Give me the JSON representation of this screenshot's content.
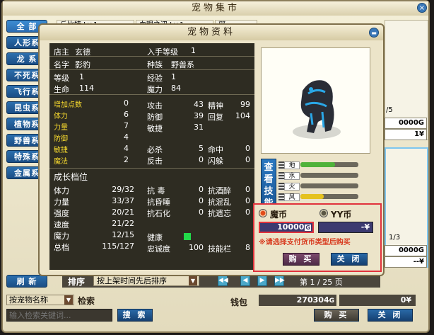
{
  "market": {
    "title": "宠物集市",
    "categories": [
      "全 部",
      "人形系",
      "龙 系",
      "不死系",
      "飞行系",
      "昆虫系",
      "植物系",
      "野兽系",
      "特殊系",
      "金属系"
    ],
    "bg_tab_labels": [
      "丘比特 Lv.1",
      "血眼之辺 Lv.1",
      "邪"
    ],
    "refresh_label": "刷 新",
    "sort_label": "排序",
    "sort_value": "按上架时间先后排序",
    "page_label": "第",
    "page_current": "1",
    "page_sep": "/",
    "page_total": "25",
    "page_unit": "页",
    "search_mode": "按宠物名称",
    "search_label": "检索",
    "search_placeholder": "输入检索关键词...",
    "search_button": "搜 索",
    "wallet_label": "钱包",
    "wallet_gold": "270304",
    "wallet_gold_unit": "G",
    "wallet_yy": "0",
    "wallet_yy_unit": "¥",
    "buy_label": "购 买",
    "close_label": "关 闭",
    "right_prices": [
      "0000G",
      "1¥",
      "0000G",
      "--¥"
    ],
    "right_level_1": "/5",
    "right_level_2": "1/3"
  },
  "info": {
    "title": "宠物资料",
    "owner_label": "店主",
    "owner": "玄德",
    "entry_label": "入手等级",
    "entry": "1",
    "name_label": "名字",
    "name": "影豹",
    "race_label": "种族",
    "race": "野兽系",
    "level_label": "等级",
    "level": "1",
    "exp_label": "经验",
    "exp": "1",
    "hp_label": "生命",
    "hp": "114",
    "mp_label": "魔力",
    "mp": "84",
    "points": [
      {
        "label": "增加点数",
        "value": "0"
      },
      {
        "label": "体力",
        "value": "6"
      },
      {
        "label": "力量",
        "value": "7"
      },
      {
        "label": "防御",
        "value": "4"
      },
      {
        "label": "敏捷",
        "value": "4"
      },
      {
        "label": "魔法",
        "value": "2"
      }
    ],
    "attack_label": "攻击",
    "attack": "43",
    "spirit_label": "精神",
    "spirit": "99",
    "defense_label": "防御",
    "defense": "39",
    "recover_label": "回复",
    "recover": "104",
    "agility_label": "敏捷",
    "agility": "31",
    "crit_label": "必杀",
    "crit": "5",
    "hit_label": "命中",
    "hit": "0",
    "counter_label": "反击",
    "counter": "0",
    "dodge_label": "闪躲",
    "dodge": "0",
    "growth_title": "成长档位",
    "growth": [
      {
        "label": "体力",
        "value": "29/32"
      },
      {
        "label": "力量",
        "value": "33/37"
      },
      {
        "label": "强度",
        "value": "20/21"
      },
      {
        "label": "速度",
        "value": "21/22"
      },
      {
        "label": "魔力",
        "value": "12/15"
      },
      {
        "label": "总档",
        "value": "115/127"
      }
    ],
    "resists": [
      {
        "label": "抗 毒",
        "value": "0"
      },
      {
        "label": "抗酒醉",
        "value": "0"
      },
      {
        "label": "抗昏睡",
        "value": "0"
      },
      {
        "label": "抗混乱",
        "value": "0"
      },
      {
        "label": "抗石化",
        "value": "0"
      },
      {
        "label": "抗遗忘",
        "value": "0"
      }
    ],
    "health_label": "健康",
    "loyalty_label": "忠诚度",
    "loyalty": "100",
    "skill_slot_label": "技能栏",
    "skill_slot": "8",
    "skill_button": "查看技能",
    "elements": [
      {
        "label": "地",
        "level": 0.6,
        "color": "#4fb23a"
      },
      {
        "label": "水",
        "level": 0.0,
        "color": "#3a7ad9"
      },
      {
        "label": "火",
        "level": 0.0,
        "color": "#d9482e"
      },
      {
        "label": "风",
        "level": 0.4,
        "color": "#e5c21f"
      }
    ]
  },
  "purchase": {
    "currency_a": "魔币",
    "currency_b": "YY币",
    "price_a": "10000",
    "price_a_unit": "G",
    "price_b": "-",
    "price_b_unit": "¥",
    "hint": "※请选择支付货币类型后购买",
    "buy": "购 买",
    "close": "关 闭"
  },
  "colors": {
    "accent_blue": "#1b4e85",
    "highlight_red": "#e1323c",
    "stats_bg": "#2e2c22",
    "gold_text": "#f5d82e"
  }
}
